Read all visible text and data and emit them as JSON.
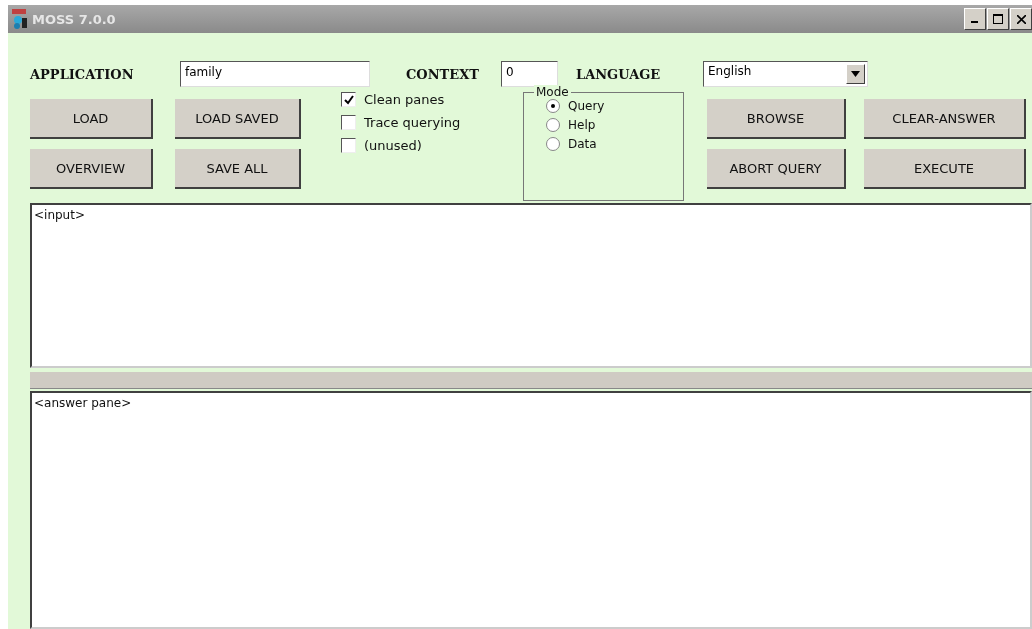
{
  "window": {
    "title": "MOSS 7.0.0"
  },
  "fields": [
    {
      "kind": "text",
      "label": "APPLICATION",
      "value": "family"
    },
    {
      "kind": "text",
      "label": "CONTEXT",
      "value": "0"
    },
    {
      "kind": "select",
      "label": "LANGUAGE",
      "value": "English"
    }
  ],
  "left_buttons": [
    [
      "LOAD",
      "LOAD SAVED"
    ],
    [
      "OVERVIEW",
      "SAVE ALL"
    ]
  ],
  "checkboxes": [
    {
      "label": "Clean panes",
      "checked": true
    },
    {
      "label": "Trace querying",
      "checked": false
    },
    {
      "label": "(unused)",
      "checked": false
    }
  ],
  "mode": {
    "title": "Mode",
    "options": [
      {
        "label": "Query",
        "selected": true
      },
      {
        "label": "Help",
        "selected": false
      },
      {
        "label": "Data",
        "selected": false
      }
    ]
  },
  "right_buttons": [
    [
      "BROWSE",
      "CLEAR-ANSWER"
    ],
    [
      "ABORT QUERY",
      "EXECUTE"
    ]
  ],
  "input_pane": "<input>",
  "answer_pane": "<answer pane>"
}
